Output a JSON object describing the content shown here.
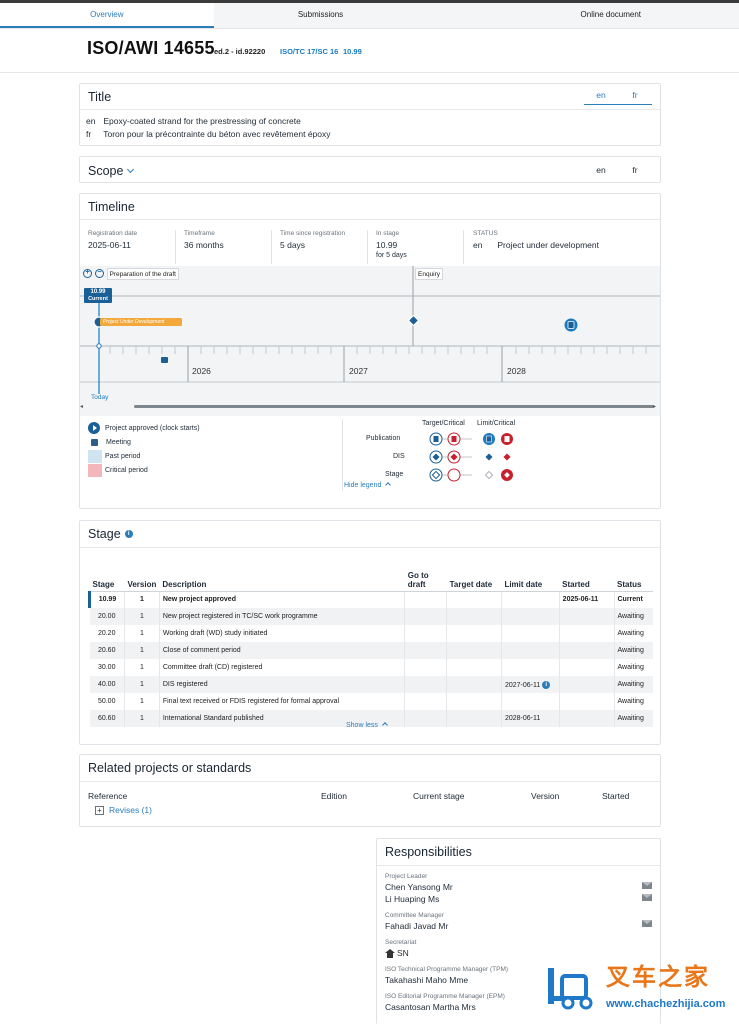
{
  "nav": {
    "tabs": [
      {
        "label": "Overview",
        "active": true
      },
      {
        "label": "Submissions",
        "active": false
      },
      {
        "label": "Online document",
        "active": false
      }
    ]
  },
  "header": {
    "code": "ISO/AWI 14655",
    "edition": "ed.2 - id.92220",
    "committee": "ISO/TC 17/SC 16",
    "stage": "10.99"
  },
  "title_section": {
    "heading": "Title",
    "lang_tabs": [
      "en",
      "fr"
    ],
    "rows": [
      {
        "lang": "en",
        "text": "Epoxy-coated strand for the prestressing of concrete"
      },
      {
        "lang": "fr",
        "text": "Toron pour la précontrainte du béton avec revêtement époxy"
      }
    ]
  },
  "scope_section": {
    "heading": "Scope",
    "lang_tabs": [
      "en",
      "fr"
    ]
  },
  "timeline": {
    "heading": "Timeline",
    "registration_label": "Registration date",
    "registration_value": "2025-06-11",
    "timeframe_label": "Timeframe",
    "timeframe_value": "36 months",
    "since_label": "Time since registration",
    "since_value": "5 days",
    "instage_label": "In stage",
    "instage_value": "10.99",
    "instage_sub": "for 5 days",
    "status_label": "STATUS",
    "status_lang": "en",
    "status_value": "Project under development",
    "phase_prep": "Preparation of the draft",
    "phase_enquiry": "Enquiry",
    "current_marker": "10.99",
    "current_sub": "Current",
    "dev_bar_label": "Project Under Development",
    "years": [
      "2026",
      "2027",
      "2028"
    ],
    "today_label": "Today",
    "legend": {
      "items": [
        {
          "label": "Project approved (clock starts)",
          "color": "#1a5f95"
        },
        {
          "label": "Meeting",
          "color": "#2b5f8a"
        },
        {
          "label": "Past period",
          "color": "#cfe3f1"
        },
        {
          "label": "Critical period",
          "color": "#f3b6bb"
        }
      ],
      "col_target": "Target/Critical",
      "col_limit": "Limit/Critical",
      "rows": [
        "Publication",
        "DIS",
        "Stage"
      ],
      "hide_label": "Hide legend"
    }
  },
  "stage_section": {
    "heading": "Stage",
    "columns": [
      "Stage",
      "Version",
      "Description",
      "Go to draft",
      "Target date",
      "Limit date",
      "Started",
      "Status"
    ],
    "rows": [
      {
        "stage": "10.99",
        "version": "1",
        "description": "New project approved",
        "limit": "",
        "started": "2025-06-11",
        "status": "Current"
      },
      {
        "stage": "20.00",
        "version": "1",
        "description": "New project registered in TC/SC work programme",
        "limit": "",
        "started": "",
        "status": "Awaiting"
      },
      {
        "stage": "20.20",
        "version": "1",
        "description": "Working draft (WD) study initiated",
        "limit": "",
        "started": "",
        "status": "Awaiting"
      },
      {
        "stage": "20.60",
        "version": "1",
        "description": "Close of comment period",
        "limit": "",
        "started": "",
        "status": "Awaiting"
      },
      {
        "stage": "30.00",
        "version": "1",
        "description": "Committee draft (CD) registered",
        "limit": "",
        "started": "",
        "status": "Awaiting"
      },
      {
        "stage": "40.00",
        "version": "1",
        "description": "DIS registered",
        "limit": "2027-06-11",
        "started": "",
        "status": "Awaiting"
      },
      {
        "stage": "50.00",
        "version": "1",
        "description": "Final text received or FDIS registered for formal approval",
        "limit": "",
        "started": "",
        "status": "Awaiting"
      },
      {
        "stage": "60.60",
        "version": "1",
        "description": "International Standard published",
        "limit": "2028-06-11",
        "started": "",
        "status": "Awaiting"
      }
    ],
    "show_less": "Show less"
  },
  "related": {
    "heading": "Related projects or standards",
    "columns": [
      "Reference",
      "Edition",
      "Current stage",
      "Version",
      "Started"
    ],
    "revises": "Revises (1)"
  },
  "responsibilities": {
    "heading": "Responsibilities",
    "project_leader_label": "Project Leader",
    "leader_1": "Chen Yansong Mr",
    "leader_2": "Li Huaping Ms",
    "committee_manager_label": "Committee Manager",
    "committee_manager": "Fahadi Javad Mr",
    "secretariat_label": "Secretariat",
    "secretariat": "SN",
    "tpm_label": "ISO Technical Programme Manager (TPM)",
    "tpm": "Takahashi Maho Mme",
    "epm_label": "ISO Editorial Programme Manager (EPM)",
    "epm": "Casantosan Martha Mrs"
  },
  "watermark": {
    "brand": "叉车之家",
    "url": "www.chachezhijia.com"
  },
  "colors": {
    "accent": "#2b7db9",
    "dark_blue": "#1a5f95",
    "critical_red": "#c8202d",
    "dev_orange": "#f3a83b"
  }
}
